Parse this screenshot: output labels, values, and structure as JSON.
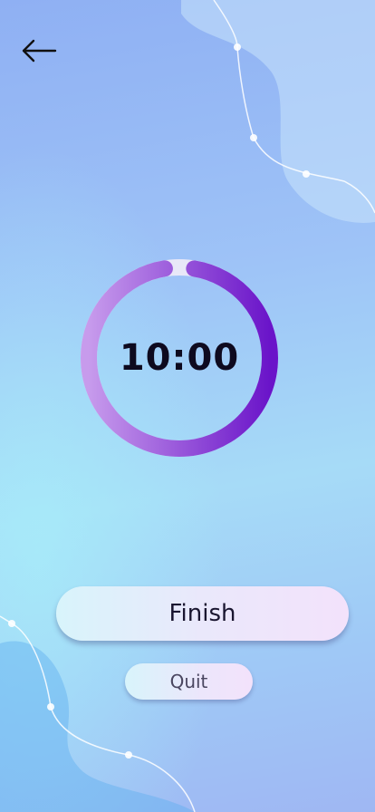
{
  "header": {
    "back_icon": "arrow-left-icon"
  },
  "timer": {
    "display": "10:00",
    "progress": 0.97
  },
  "actions": {
    "finish_label": "Finish",
    "quit_label": "Quit"
  },
  "colors": {
    "ring_start": "#c79bec",
    "ring_end": "#6a14c9",
    "ring_track": "#e8e8f8",
    "button_gradient_start": "#d8f4fb",
    "button_gradient_end": "#f3e2fb"
  }
}
